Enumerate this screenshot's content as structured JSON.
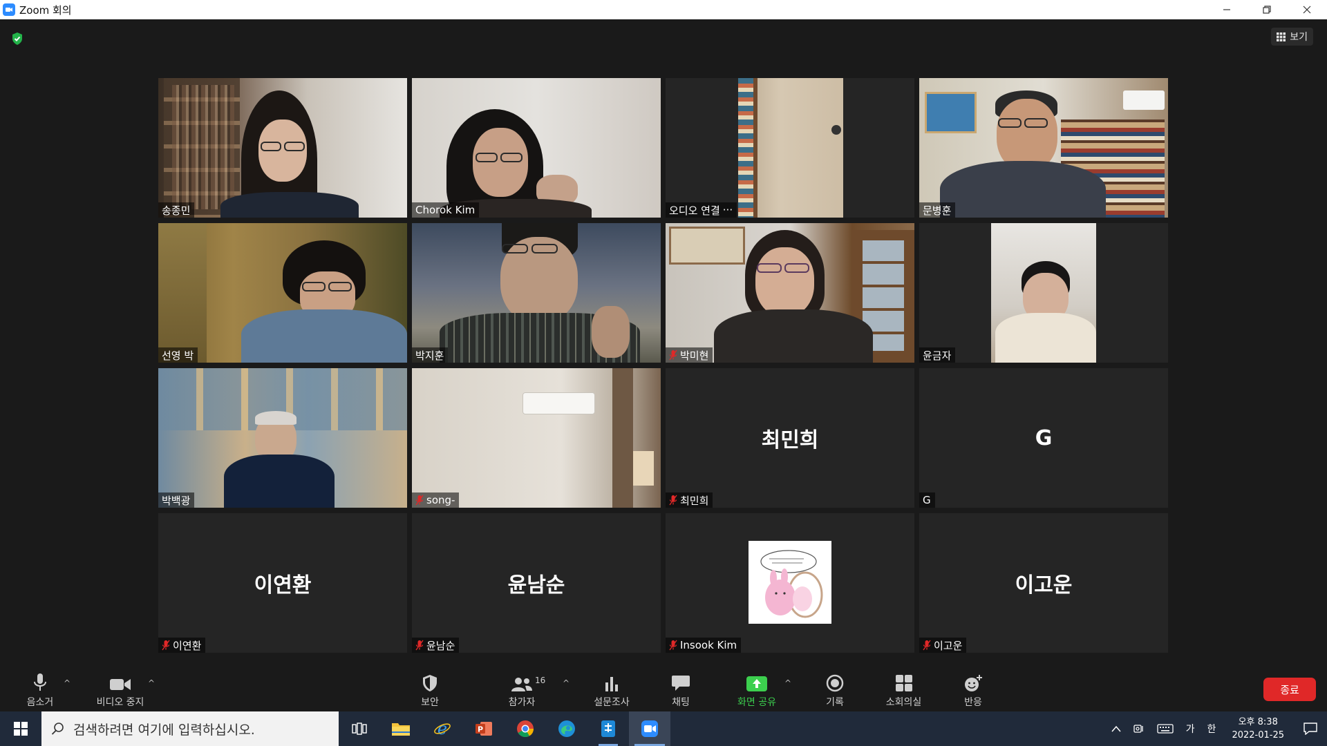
{
  "window": {
    "title": "Zoom 회의",
    "minimize": "—",
    "restore": "❐",
    "close": "✕"
  },
  "meeting": {
    "view_label": "보기",
    "tiles": [
      {
        "name": "송종민",
        "muted": false,
        "video": true
      },
      {
        "name": "Chorok Kim",
        "muted": false,
        "video": true
      },
      {
        "name": "오디오 연결",
        "muted": false,
        "video": true,
        "extra": "···"
      },
      {
        "name": "문병훈",
        "muted": false,
        "video": true
      },
      {
        "name": "선영 박",
        "muted": false,
        "video": true
      },
      {
        "name": "박지훈",
        "muted": false,
        "video": true,
        "active_speaker": true
      },
      {
        "name": "박미현",
        "muted": true,
        "video": true
      },
      {
        "name": "윤금자",
        "muted": false,
        "video": true
      },
      {
        "name": "박백광",
        "muted": false,
        "video": true
      },
      {
        "name": "song-",
        "muted": true,
        "video": true
      },
      {
        "name": "최민희",
        "display_name": "최민희",
        "muted": true,
        "video": false
      },
      {
        "name": "G",
        "display_name": "G",
        "muted": false,
        "video": false
      },
      {
        "name": "이연환",
        "display_name": "이연환",
        "muted": true,
        "video": false
      },
      {
        "name": "윤남순",
        "display_name": "윤남순",
        "muted": true,
        "video": false
      },
      {
        "name": "Insook Kim",
        "muted": true,
        "video": false,
        "profile_picture": true
      },
      {
        "name": "이고운",
        "display_name": "이고운",
        "muted": true,
        "video": false
      }
    ]
  },
  "toolbar": {
    "mute_label": "음소거",
    "video_label": "비디오 중지",
    "security_label": "보안",
    "participants_label": "참가자",
    "participants_count": "16",
    "polls_label": "설문조사",
    "chat_label": "채팅",
    "share_label": "화면 공유",
    "record_label": "기록",
    "breakout_label": "소회의실",
    "reactions_label": "반응",
    "end_label": "종료",
    "caret": "^",
    "share_color": "#3ccf4e",
    "end_color": "#e02828"
  },
  "taskbar": {
    "search_placeholder": "검색하려면 여기에 입력하십시오.",
    "ime_mode": "가",
    "ime_lang": "한",
    "time": "오후 8:38",
    "date": "2022-01-25"
  },
  "colors": {
    "active_speaker_border": "#d9e84a",
    "zoom_blue": "#2d8cff",
    "tile_bg": "#252525"
  }
}
